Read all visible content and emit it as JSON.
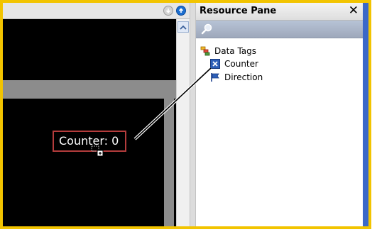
{
  "pane": {
    "title": "Resource Pane",
    "close": "✕"
  },
  "tree": {
    "root": "Data Tags",
    "items": [
      {
        "label": "Counter",
        "icon": "variable-x-icon"
      },
      {
        "label": "Direction",
        "icon": "flag-icon"
      }
    ]
  },
  "canvas": {
    "counter_text": "Counter: 0"
  },
  "colors": {
    "frame": "#f2c400",
    "counter_border": "#b43c3c",
    "nav_up": "#1d6fd0",
    "pane_edge": "#3b68c8"
  }
}
